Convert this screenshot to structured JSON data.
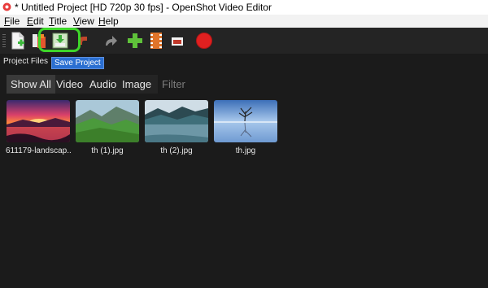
{
  "window": {
    "title": "* Untitled Project [HD 720p 30 fps] - OpenShot Video Editor",
    "icon": "openshot-logo-icon"
  },
  "menu": {
    "items": [
      {
        "label": "File",
        "mnemonic": "F"
      },
      {
        "label": "Edit",
        "mnemonic": "E"
      },
      {
        "label": "Title",
        "mnemonic": "T"
      },
      {
        "label": "View",
        "mnemonic": "V"
      },
      {
        "label": "Help",
        "mnemonic": "H"
      }
    ]
  },
  "toolbar": {
    "buttons": [
      {
        "name": "new-project",
        "icon": "new-file-icon"
      },
      {
        "name": "open-project",
        "icon": "open-folder-icon"
      },
      {
        "name": "save-project",
        "icon": "save-download-icon",
        "highlighted": true
      },
      {
        "name": "undo",
        "icon": "undo-icon"
      },
      {
        "name": "redo",
        "icon": "redo-icon"
      },
      {
        "name": "import-files",
        "icon": "plus-icon"
      },
      {
        "name": "choose-profile",
        "icon": "film-strip-icon"
      },
      {
        "name": "fullscreen",
        "icon": "clapperboard-icon"
      },
      {
        "name": "export-video",
        "icon": "record-icon"
      }
    ],
    "tooltip": "Save Project",
    "highlight_color": "#3ed62a"
  },
  "project_files": {
    "label": "Project Files",
    "tabs": [
      "Show All",
      "Video",
      "Audio",
      "Image"
    ],
    "active_tab": "Show All",
    "filter_placeholder": "Filter",
    "filter_value": "",
    "files": [
      {
        "name": "611179-landscap...",
        "thumb": "sunset-lake-thumbnail"
      },
      {
        "name": "th (1).jpg",
        "thumb": "green-mountains-thumbnail"
      },
      {
        "name": "th (2).jpg",
        "thumb": "misty-lake-thumbnail"
      },
      {
        "name": "th.jpg",
        "thumb": "lone-tree-lake-thumbnail"
      }
    ]
  }
}
